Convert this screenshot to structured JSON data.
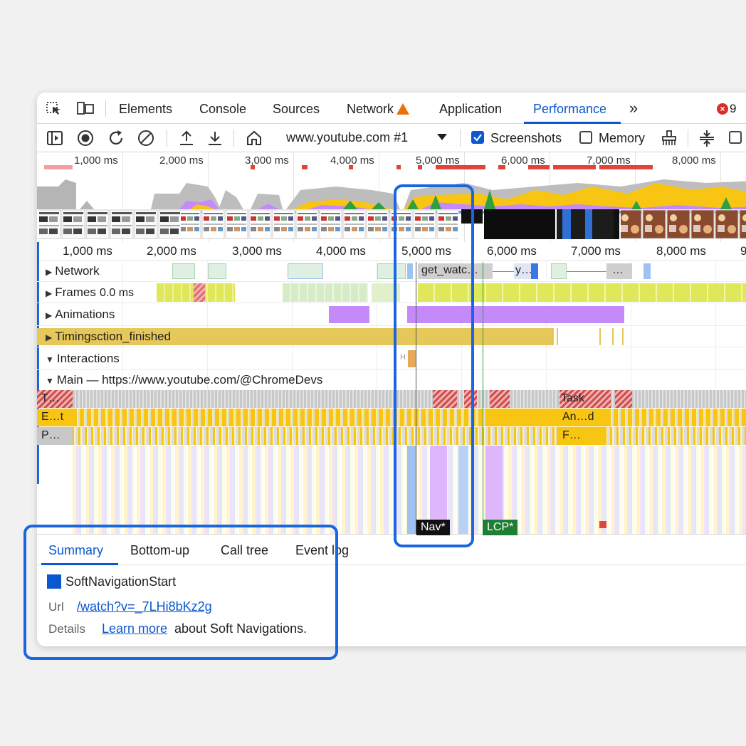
{
  "tabs": {
    "elements": "Elements",
    "console": "Console",
    "sources": "Sources",
    "network": "Network",
    "application": "Application",
    "performance": "Performance",
    "more": "»",
    "error_count": "9"
  },
  "toolbar": {
    "recording_url": "www.youtube.com #1",
    "screenshots_label": "Screenshots",
    "memory_label": "Memory",
    "screenshots_checked": true,
    "memory_checked": false
  },
  "overview_ticks": [
    "1,000 ms",
    "2,000 ms",
    "3,000 ms",
    "4,000 ms",
    "5,000 ms",
    "6,000 ms",
    "7,000 ms",
    "8,000 ms"
  ],
  "ruler_ticks": [
    "1,000 ms",
    "2,000 ms",
    "3,000 ms",
    "4,000 ms",
    "5,000 ms",
    "6,000 ms",
    "7,000 ms",
    "8,000 ms",
    "9"
  ],
  "tracks": {
    "network": "Network",
    "network_request": "get_watc…",
    "network_request2": "y…",
    "network_request3": "…",
    "frames": "Frames",
    "frames_value": "0.0 ms",
    "animations": "Animations",
    "timings": "Timings",
    "timings_overlay": "ction_finished",
    "interactions": "Interactions",
    "interaction_label": "H",
    "main": "Main — https://www.youtube.com/@ChromeDevs"
  },
  "flame": {
    "row1_left": "T…",
    "row1_right": "Task",
    "row2_left": "E…t",
    "row2_right": "An…d",
    "row3_left": "P…",
    "row3_right": "F…",
    "nav_marker": "Nav*",
    "lcp_marker": "LCP*"
  },
  "bottom": {
    "tabs": [
      "Summary",
      "Bottom-up",
      "Call tree",
      "Event log"
    ],
    "event_title": "SoftNavigationStart",
    "url_label": "Url",
    "url_value": "/watch?v=_7LHi8bKz2g",
    "details_label": "Details",
    "details_link": "Learn more",
    "details_text": "about Soft Navigations."
  },
  "colors": {
    "accent": "#0b57d0",
    "highlight": "#1a66e0",
    "scripting": "#f9c513",
    "rendering": "#c58af9",
    "system": "#c8c8c8",
    "frames": "#dfe85a",
    "network": "#cfe8d4",
    "timings": "#e6c75a"
  }
}
